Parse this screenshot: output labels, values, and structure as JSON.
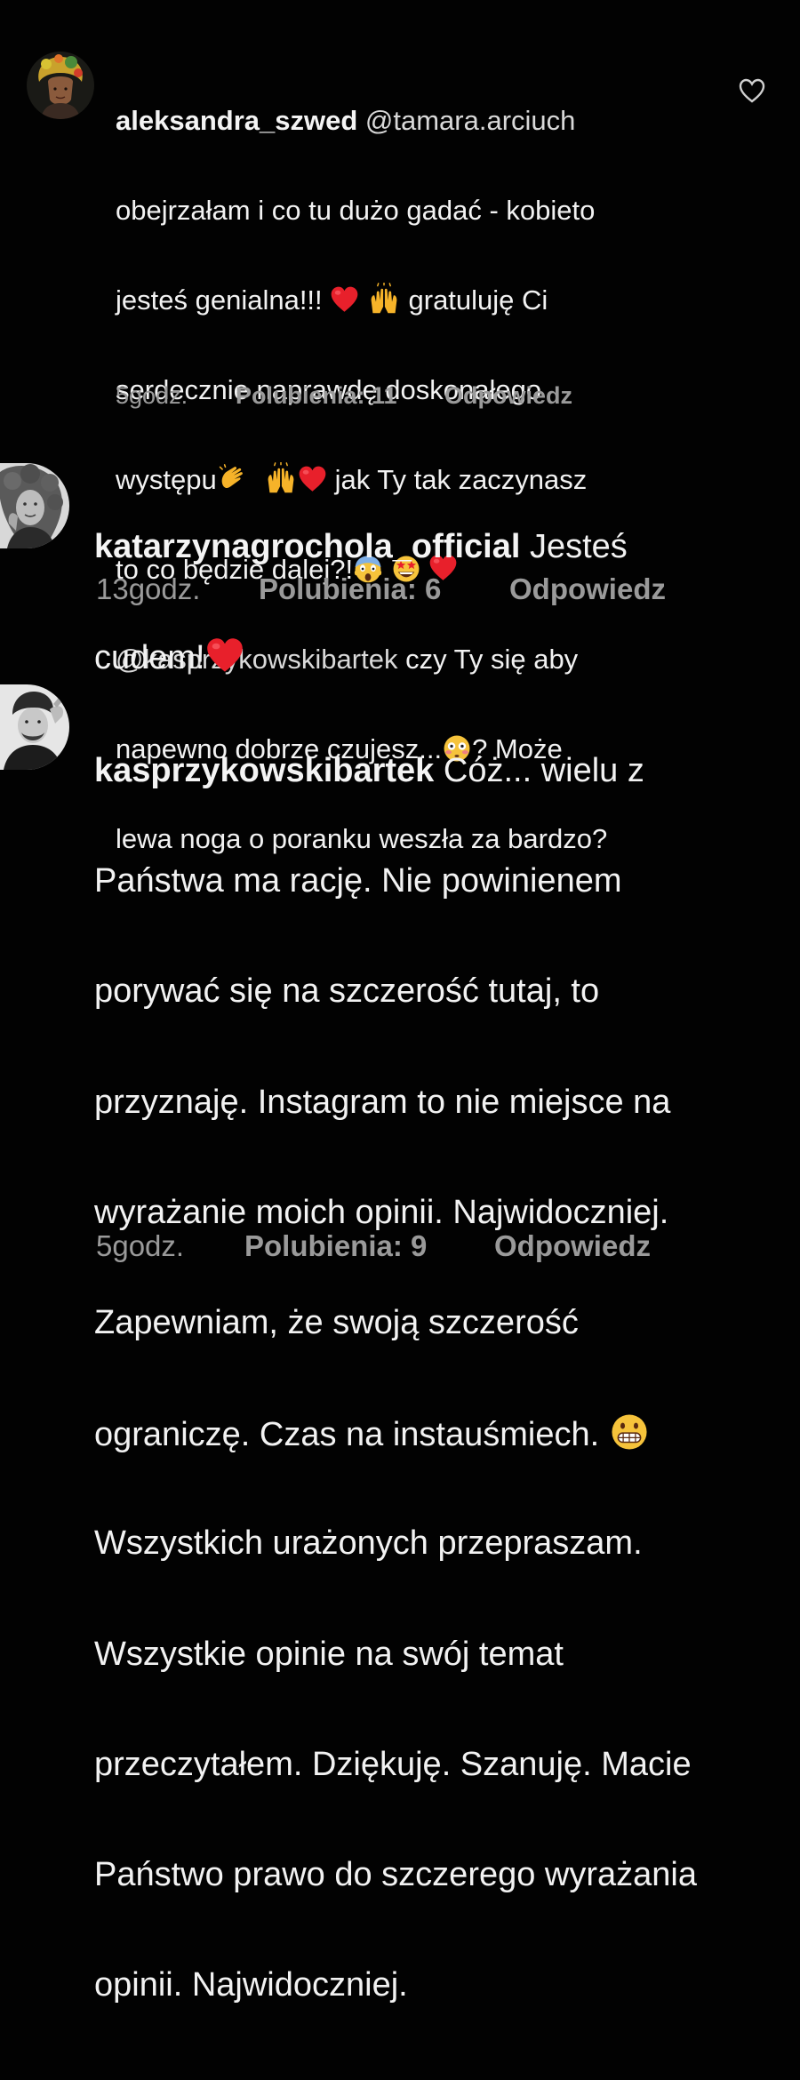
{
  "comments": [
    {
      "username": "aleksandra_szwed",
      "lines": [
        {
          "mention": "@tamara.arciuch"
        },
        {
          "text": "obejrzałam i co tu dużo gadać - kobieto"
        },
        {
          "a": "jesteś genialna!!! ",
          "b": " gratuluję Ci"
        },
        {
          "text": "serdecznie naprawdę doskonałego"
        },
        {
          "a": "występu",
          "b": " jak Ty tak zaczynasz"
        },
        {
          "a": "to co będzie dalej?!"
        },
        {
          "mention": "@kasprzykowskibartek",
          "rest": " czy Ty się aby"
        },
        {
          "a": "napewno dobrze czujesz...",
          "b": "? Może"
        },
        {
          "text": "lewa noga o poranku weszła za bardzo?"
        }
      ],
      "time": "5godz.",
      "likes": "Polubienia: 11",
      "reply": "Odpowiedz",
      "emojis": [
        "heart-emoji",
        "raising-hands-emoji",
        "clapping-hands-emoji",
        "raising-hands-emoji",
        "heart-emoji",
        "screaming-face-emoji",
        "star-struck-emoji",
        "heart-emoji",
        "flushed-face-emoji"
      ]
    },
    {
      "username": "katarzynagrochola_official",
      "lines": [
        {
          "rest": " Jesteś"
        },
        {
          "a": "cudem!"
        }
      ],
      "time": "13godz.",
      "likes": "Polubienia: 6",
      "reply": "Odpowiedz",
      "emojis": [
        "heart-emoji"
      ]
    },
    {
      "username": "kasprzykowskibartek",
      "lines": [
        {
          "rest": " Cóż... wielu z"
        },
        {
          "text": "Państwa ma rację. Nie powinienem"
        },
        {
          "text": "porywać się na szczerość tutaj, to"
        },
        {
          "text": "przyznaję. Instagram to nie miejsce na"
        },
        {
          "text": "wyrażanie moich opinii. Najwidoczniej."
        },
        {
          "text": "Zapewniam, że swoją szczerość"
        },
        {
          "a": "ograniczę. Czas na instauśmiech. "
        },
        {
          "text": "Wszystkich urażonych przepraszam."
        },
        {
          "text": "Wszystkie opinie na swój temat"
        },
        {
          "text": "przeczytałem. Dziękuję. Szanuję. Macie"
        },
        {
          "text": "Państwo prawo do szczerego wyrażania"
        },
        {
          "text": "opinii. Najwidoczniej."
        }
      ],
      "time": "5godz.",
      "likes": "Polubienia: 9",
      "reply": "Odpowiedz",
      "emojis": [
        "grimacing-face-emoji"
      ]
    }
  ],
  "colors": {
    "background": "#020202",
    "text": "#f2f2f2",
    "meta": "#9a9a9a",
    "heart": "#e8202b"
  },
  "icons": {
    "like": "heart-outline-icon"
  }
}
